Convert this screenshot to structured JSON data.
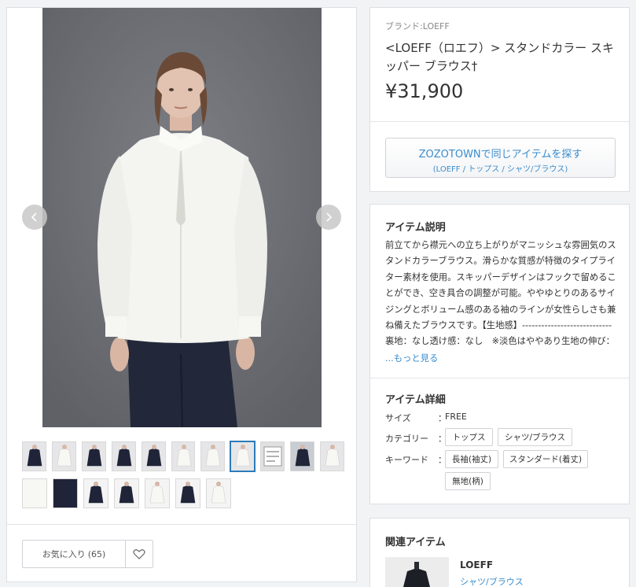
{
  "gallery": {
    "thumbs_row1": [
      "navy-polo",
      "white-shirt",
      "navy-jacket",
      "navy-shirt-open",
      "navy-dress-side",
      "white-shirt-model",
      "white-blouse-model",
      "white-blouse-front",
      "care-label",
      "navy-outdoor",
      "white-full"
    ],
    "thumbs_row2": [
      "white-fabric",
      "navy-fabric",
      "navy-folded",
      "navy-sleeve",
      "white-flat",
      "navy-flat",
      "white-collar"
    ],
    "selected_index": 7
  },
  "favorite": {
    "label": "お気に入り",
    "count": "(65)"
  },
  "product": {
    "brand": "ブランド:LOEFF",
    "title": "<LOEFF（ロエフ）> スタンドカラー スキッパー ブラウス†",
    "price": "¥31,900",
    "zozo_main": "ZOZOTOWNで同じアイテムを探す",
    "zozo_sub": "(LOEFF / トップス / シャツ/ブラウス)"
  },
  "description": {
    "heading": "アイテム説明",
    "text": "前立てから襟元への立ち上がりがマニッシュな雰囲気のスタンドカラーブラウス。滑らかな質感が特徴のタイプライター素材を使用。スキッパーデザインはフックで留めることができ、空き具合の調整が可能。ややゆとりのあるサイジングとボリューム感のある袖のラインが女性らしさも兼ね備えたブラウスです。【生地感】---------------------------- 裏地：なし透け感：なし　※淡色はややあり生地の伸び：なし光沢感：なし------------------------【ケア方法】手洗",
    "more": "...もっと見る"
  },
  "details": {
    "heading": "アイテム詳細",
    "size_label": "サイズ",
    "size_value": "FREE",
    "category_label": "カテゴリー",
    "categories": [
      "トップス",
      "シャツ/ブラウス"
    ],
    "keyword_label": "キーワード",
    "keywords": [
      "長袖(袖丈)",
      "スタンダード(着丈)",
      "無地(柄)"
    ],
    "colon": "："
  },
  "related": {
    "heading": "関連アイテム",
    "brand": "LOEFF",
    "category": "シャツ/ブラウス"
  },
  "colors": {
    "link": "#3a8ccc",
    "selected_outline": "#2b7bb9",
    "backdrop": "#6f7177"
  }
}
